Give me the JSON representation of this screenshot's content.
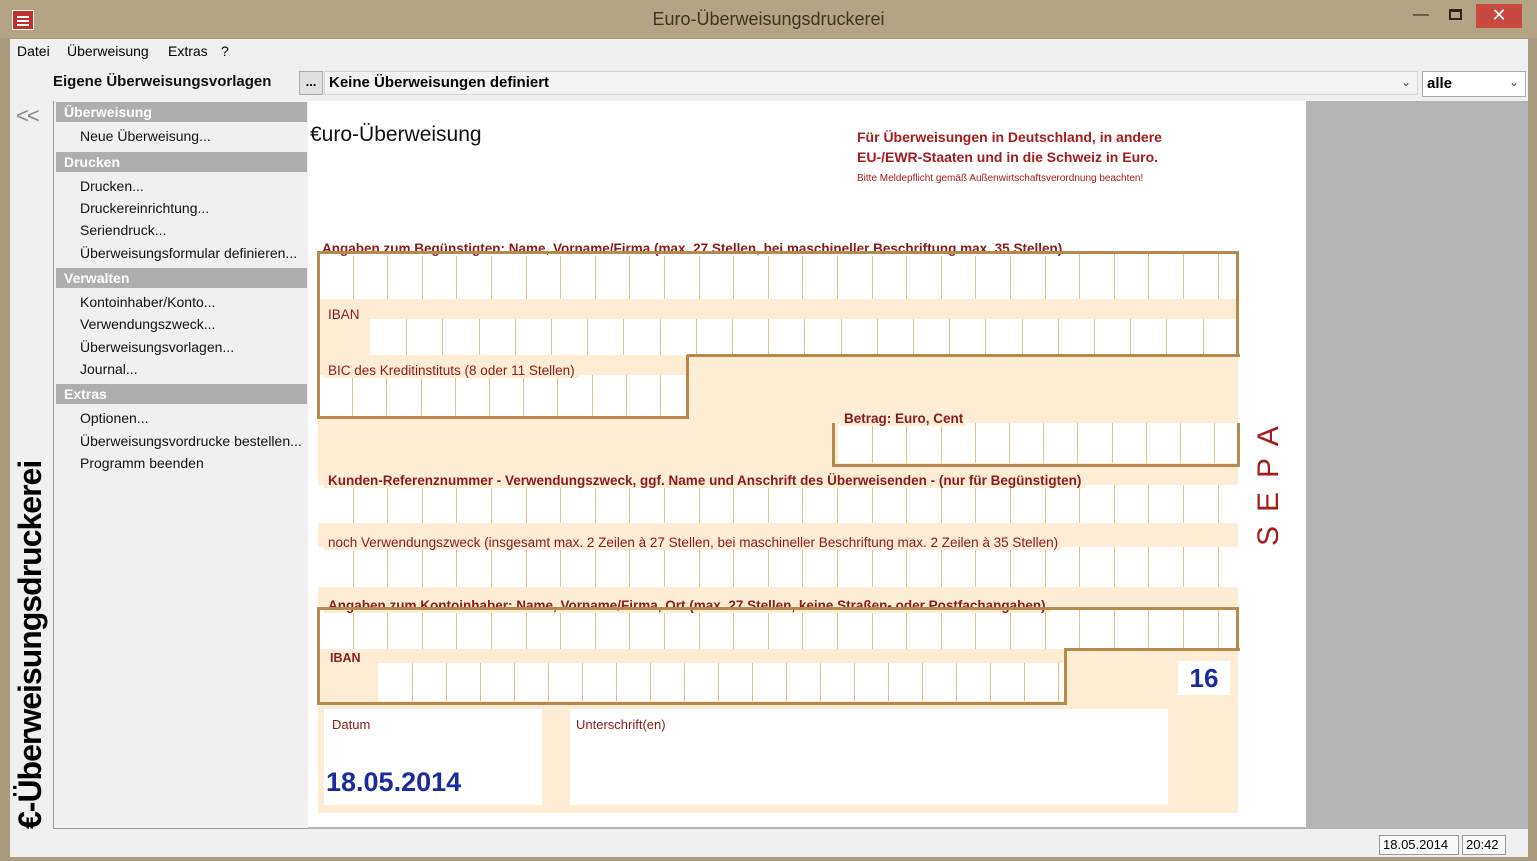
{
  "window": {
    "title": "Euro-Überweisungsdruckerei",
    "minimize": "—",
    "close": "✕"
  },
  "menu": [
    "Datei",
    "Überweisung",
    "Extras",
    "?"
  ],
  "toolbar": {
    "templates_label": "Eigene Überweisungsvorlagen",
    "browse_button": "...",
    "template_select": "Keine Überweisungen definiert",
    "filter_select": "alle"
  },
  "collapse_button": "<<",
  "vertical_logo": "€-Überweisungsdruckerei",
  "sidebar": {
    "sections": [
      {
        "title": "Überweisung",
        "items": [
          "Neue Überweisung..."
        ]
      },
      {
        "title": "Drucken",
        "items": [
          "Drucken...",
          "Druckereinrichtung...",
          "Seriendruck...",
          "Überweisungsformular definieren..."
        ]
      },
      {
        "title": "Verwalten",
        "items": [
          "Kontoinhaber/Konto...",
          "Verwendungszweck...",
          "Überweisungsvorlagen...",
          "Journal..."
        ]
      },
      {
        "title": "Extras",
        "items": [
          "Optionen...",
          "Überweisungsvordrucke bestellen...",
          "Programm beenden"
        ]
      }
    ]
  },
  "form": {
    "title": "€uro-Überweisung",
    "note_line1": "Für Überweisungen in Deutschland, in andere",
    "note_line2": "EU-/EWR-Staaten und in die Schweiz in Euro.",
    "note_small": "Bitte Meldepflicht gemäß Außenwirtschaftsverordnung beachten!",
    "beneficiary_label": "Angaben zum Begünstigten: Name, Vorname/Firma (max. 27 Stellen, bei maschineller Beschriftung max. 35 Stellen)",
    "iban_label": "IBAN",
    "bic_label": "BIC des Kreditinstituts (8 oder 11 Stellen)",
    "amount_label": "Betrag: Euro, Cent",
    "reference_label": "Kunden-Referenznummer - Verwendungszweck, ggf. Name und Anschrift des Überweisenden - (nur für Begünstigten)",
    "purpose2_label": "noch Verwendungszweck (insgesamt max. 2 Zeilen à 27 Stellen, bei maschineller Beschriftung max. 2 Zeilen à 35 Stellen)",
    "holder_label": "Angaben zum Kontoinhaber: Name, Vorname/Firma, Ort (max. 27 Stellen, keine Straßen- oder Postfachangaben)",
    "holder_iban_label": "IBAN",
    "sepa": "SEPA",
    "form_number": "16",
    "date_label": "Datum",
    "date_value": "18.05.2014",
    "signature_label": "Unterschrift(en)"
  },
  "status": {
    "date": "18.05.2014",
    "time": "20:42"
  },
  "colors": {
    "accent_red": "#a41c1c",
    "frame_brown": "#b58a4c",
    "form_bg": "#fcedd4",
    "value_blue": "#1a2b9c"
  },
  "icons": {
    "app": "app-printer-icon",
    "dropdown": "chevron-down-icon"
  }
}
